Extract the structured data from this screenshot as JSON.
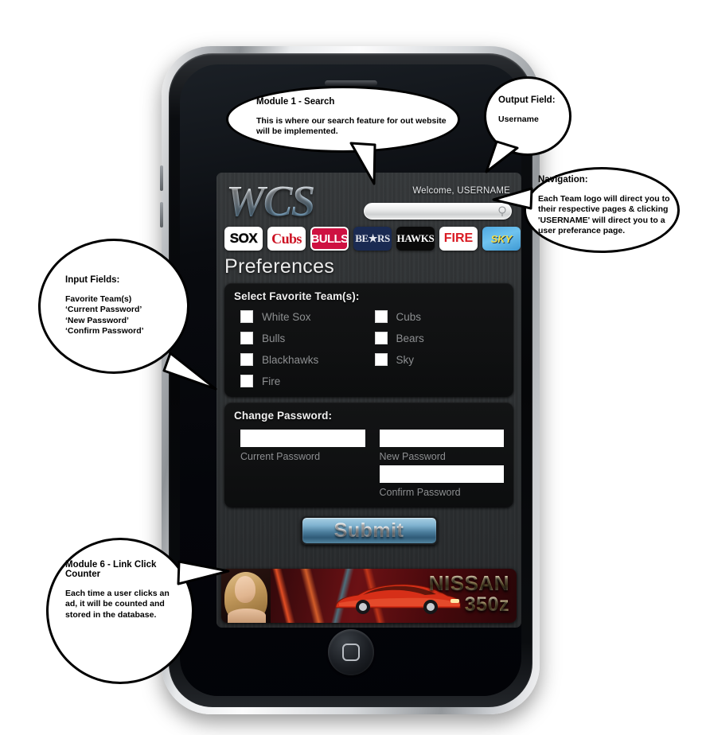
{
  "device": {
    "name": "smartphone-mockup"
  },
  "site": {
    "logo_text": "WCS",
    "welcome_text": "Welcome, USERNAME",
    "search": {
      "value": "",
      "placeholder": ""
    },
    "teams_nav": [
      {
        "id": "sox",
        "label": "SOX"
      },
      {
        "id": "cubs",
        "label": "Cubs"
      },
      {
        "id": "bulls",
        "label": "BULLS"
      },
      {
        "id": "bears",
        "label": "BE★RS"
      },
      {
        "id": "hawks",
        "label": "HAWKS"
      },
      {
        "id": "fire",
        "label": "FIRE"
      },
      {
        "id": "sky",
        "label": "SKY"
      }
    ],
    "page_title": "Preferences",
    "favorite_teams": {
      "label": "Select Favorite Team(s):",
      "options": [
        {
          "label": "White Sox",
          "checked": false
        },
        {
          "label": "Cubs",
          "checked": false
        },
        {
          "label": "Bulls",
          "checked": false
        },
        {
          "label": "Bears",
          "checked": false
        },
        {
          "label": "Blackhawks",
          "checked": false
        },
        {
          "label": "Sky",
          "checked": false
        },
        {
          "label": "Fire",
          "checked": false
        }
      ]
    },
    "change_password": {
      "label": "Change Password:",
      "fields": [
        {
          "id": "current",
          "caption": "Current Password",
          "value": ""
        },
        {
          "id": "new",
          "caption": "New Password",
          "value": ""
        },
        {
          "id": "confirm",
          "caption": "Confirm Password",
          "value": ""
        }
      ]
    },
    "submit_label": "Submit",
    "ad": {
      "brand": "NISSAN",
      "model": "350z"
    }
  },
  "callouts": [
    {
      "id": "module-1-search",
      "title": "Module 1 - Search",
      "body": "This is where our search feature for out website will be implemented."
    },
    {
      "id": "output-field-username",
      "title": "Output Field:",
      "body": "Username"
    },
    {
      "id": "navigation",
      "title": "Navigation:",
      "body": "Each Team logo will direct you to their respective pages & clicking 'USERNAME' will direct you to a user preferance page."
    },
    {
      "id": "input-fields",
      "title": "Input Fields:",
      "body": "Favorite Team(s)\n‘Current Password’\n‘New Password’\n‘Confirm Password’"
    },
    {
      "id": "module-6-link-click-counter",
      "title": "Module 6 - Link Click Counter",
      "body": "Each time a user clicks an ad, it will be counted and stored in the database."
    }
  ],
  "colors": {
    "page_background": "#ffffff",
    "screen_background": "#2f3234",
    "panel_background": "#111213",
    "accent_blue": "#6d9cbc",
    "submit_blue": "#4d7f9e",
    "label_gray": "#8d8f91",
    "ad_red": "#6b1114"
  }
}
